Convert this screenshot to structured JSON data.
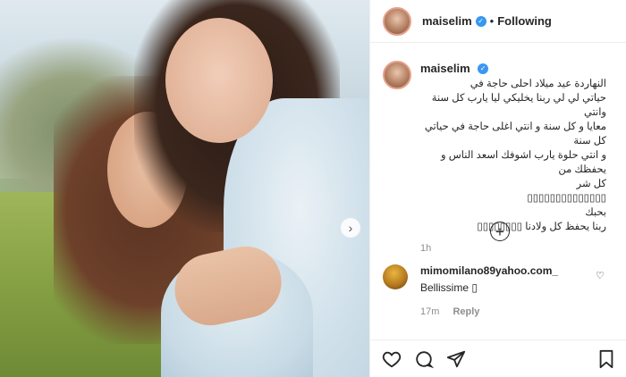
{
  "header": {
    "username": "maiselim",
    "follow_status": "Following"
  },
  "caption": {
    "username": "maiselim",
    "text": "النهاردة عيد ميلاد احلى حاجة في\nحياتي لي لي ربنا يخليكي ليا يارب كل سنة وانتي\nمعايا و كل سنة و انتي اغلى حاجة في حياتي كل سنة\nو انتي حلوة يارب اشوفك اسعد الناس و يحفظك من\nكل شر\n▯▯▯▯▯▯▯▯▯▯▯▯▯▯\nبحبك\nربنا يحفظ كل ولادنا ▯▯▯▯▯▯▯▯",
    "time": "1h"
  },
  "comment": {
    "username": "mimomilano89yahoo.com_",
    "text": "Bellissime ▯",
    "time": "17m",
    "reply_label": "Reply"
  },
  "icons": {
    "verified": "verified-badge-icon",
    "next": "chevron-right-icon",
    "load_more": "plus-circle-icon",
    "like": "heart-icon",
    "comment": "comment-bubble-icon",
    "share": "paper-plane-icon",
    "save": "bookmark-icon"
  },
  "colors": {
    "accent": "#3897f0",
    "text": "#262626",
    "muted": "#8e8e8e",
    "border": "#efefef"
  }
}
